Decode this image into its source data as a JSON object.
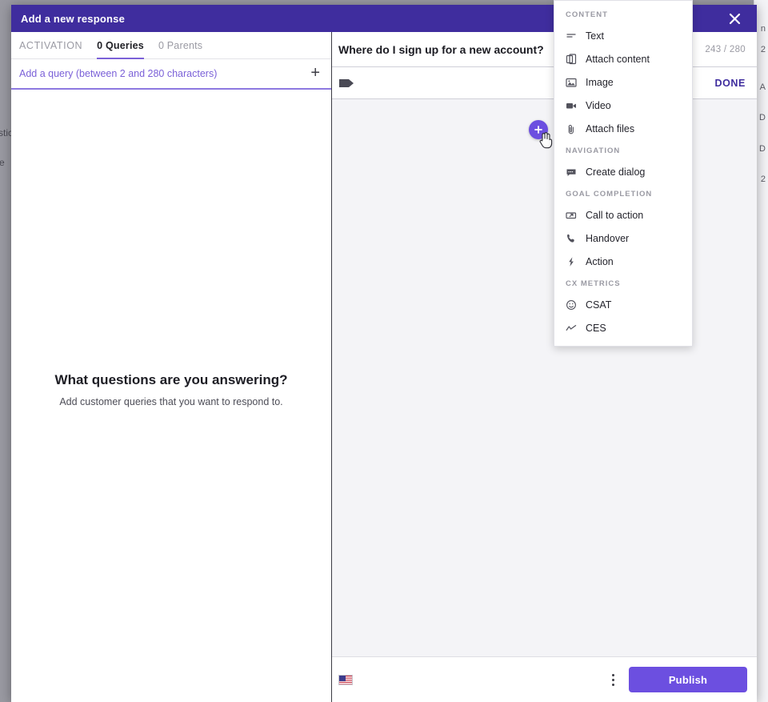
{
  "modal": {
    "title": "Add a new response",
    "close_icon": "close-icon"
  },
  "left_pane": {
    "tabs": [
      {
        "label": "ACTIVATION",
        "active": false
      },
      {
        "label": "0 Queries",
        "active": true
      },
      {
        "label": "0 Parents",
        "active": false
      }
    ],
    "query_input": {
      "placeholder": "Add a query (between 2 and 280 characters)",
      "value": "",
      "add_icon": "plus-icon"
    },
    "empty_state": {
      "title": "What questions are you answering?",
      "subtitle": "Add customer queries that you want to respond to."
    }
  },
  "right_pane": {
    "question": "Where do I sign up for a new account?",
    "char_counter": "243 / 280",
    "tag_icon": "tag-icon",
    "done_label": "DONE",
    "fab_icon": "plus-icon",
    "cursor_icon": "hand-pointer-cursor"
  },
  "footer": {
    "language_flag": "us-flag-icon",
    "more_icon": "kebab-menu-icon",
    "publish_label": "Publish"
  },
  "menu": {
    "sections": [
      {
        "label": "CONTENT",
        "items": [
          {
            "label": "Text",
            "icon": "text-lines-icon"
          },
          {
            "label": "Attach content",
            "icon": "copy-content-icon"
          },
          {
            "label": "Image",
            "icon": "image-icon"
          },
          {
            "label": "Video",
            "icon": "video-camera-icon"
          },
          {
            "label": "Attach files",
            "icon": "paperclip-icon"
          }
        ]
      },
      {
        "label": "NAVIGATION",
        "items": [
          {
            "label": "Create dialog",
            "icon": "chat-bubble-icon"
          }
        ]
      },
      {
        "label": "GOAL COMPLETION",
        "items": [
          {
            "label": "Call to action",
            "icon": "cta-box-icon"
          },
          {
            "label": "Handover",
            "icon": "phone-icon"
          },
          {
            "label": "Action",
            "icon": "lightning-bolt-icon"
          }
        ]
      },
      {
        "label": "CX METRICS",
        "items": [
          {
            "label": "CSAT",
            "icon": "smiley-face-icon"
          },
          {
            "label": "CES",
            "icon": "trend-line-icon"
          }
        ]
      }
    ]
  },
  "backdrop": {
    "left_fragments": [
      "stic",
      "e"
    ],
    "right_fragments": [
      "n",
      "2",
      "A",
      "D",
      "D",
      "2"
    ]
  },
  "colors": {
    "title_bar_purple": "#3f2d9e",
    "accent_purple": "#6c4fe0",
    "link_purple": "#7b61d8",
    "canvas_gray": "#f4f4f7",
    "muted_text": "#9a9aa3"
  }
}
